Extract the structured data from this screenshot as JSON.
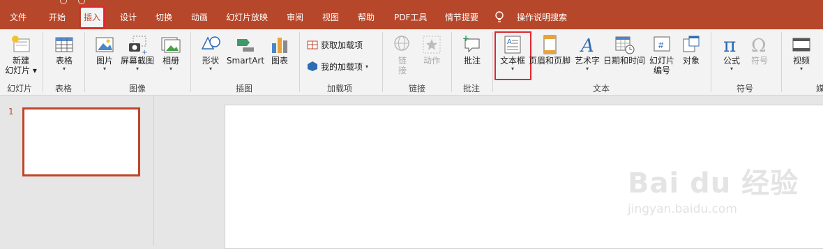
{
  "menu": {
    "tabs": [
      {
        "label": "文件"
      },
      {
        "label": "开始"
      },
      {
        "label": "插入"
      },
      {
        "label": "设计"
      },
      {
        "label": "切换"
      },
      {
        "label": "动画"
      },
      {
        "label": "幻灯片放映"
      },
      {
        "label": "审阅"
      },
      {
        "label": "视图"
      },
      {
        "label": "帮助"
      },
      {
        "label": "PDF工具"
      },
      {
        "label": "情节提要"
      }
    ],
    "active_tab": "插入",
    "help_search": "操作说明搜索"
  },
  "ribbon": {
    "slides": {
      "new_slide_line1": "新建",
      "new_slide_line2": "幻灯片",
      "group": "幻灯片"
    },
    "tables": {
      "table": "表格",
      "group": "表格"
    },
    "images": {
      "picture": "图片",
      "screenshot": "屏幕截图",
      "album": "相册",
      "group": "图像"
    },
    "illustrations": {
      "shapes": "形状",
      "smartart": "SmartArt",
      "chart": "图表",
      "group": "插图"
    },
    "addins": {
      "get": "获取加载项",
      "mine": "我的加载项",
      "group": "加载项"
    },
    "links": {
      "link_line1": "链",
      "link_line2": "接",
      "action": "动作",
      "group": "链接"
    },
    "comments": {
      "comment": "批注",
      "group": "批注"
    },
    "text": {
      "textbox": "文本框",
      "header_footer": "页眉和页脚",
      "wordart": "艺术字",
      "datetime": "日期和时间",
      "slide_no_line1": "幻灯片",
      "slide_no_line2": "编号",
      "object": "对象",
      "group": "文本"
    },
    "symbols": {
      "equation": "公式",
      "symbol": "符号",
      "group": "符号"
    },
    "media": {
      "video": "视频",
      "group_partial": "媒"
    }
  },
  "slides_pane": {
    "slide_number": "1"
  },
  "watermark": {
    "main": "Bai du 经验",
    "sub": "jingyan.baidu.com"
  },
  "colors": {
    "accent": "#b7472a",
    "highlight": "#e2262e",
    "ribbon_bg": "#f3f3f3"
  }
}
